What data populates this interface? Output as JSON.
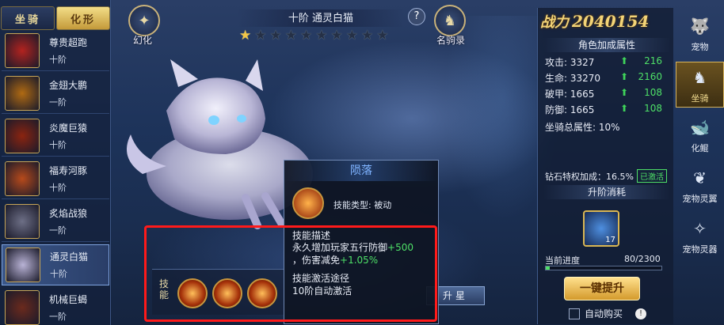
{
  "left_tabs": {
    "mount": "坐骑",
    "transform": "化形"
  },
  "mount_list": [
    {
      "name": "尊贵超跑",
      "tier": "十阶",
      "badge": "",
      "color": "#b3231f"
    },
    {
      "name": "金翅大鹏",
      "tier": "一阶",
      "badge": "",
      "color": "#b06a12"
    },
    {
      "name": "炎魔巨猿",
      "tier": "十阶",
      "badge": "",
      "color": "#8b2410"
    },
    {
      "name": "福寿河豚",
      "tier": "十阶",
      "badge": "",
      "color": "#b74a1b"
    },
    {
      "name": "炙焰战狼",
      "tier": "一阶",
      "badge": "",
      "color": "#6d6f86"
    },
    {
      "name": "通灵白猫",
      "tier": "十阶",
      "badge": "",
      "color": "#b9b3d6"
    },
    {
      "name": "机械巨蝎",
      "tier": "一阶",
      "badge": "",
      "color": "#6b2a1d"
    }
  ],
  "top": {
    "transform_label": "幻化",
    "collection_label": "名驹录",
    "title": "十阶 通灵白猫",
    "help": "?"
  },
  "stars": {
    "lit": 1,
    "total": 10
  },
  "power": {
    "label": "战力",
    "value": "2040154"
  },
  "attributes": {
    "section_title": "角色加成属性",
    "rows": [
      {
        "label": "攻击: 3327",
        "inc": "216"
      },
      {
        "label": "生命: 33270",
        "inc": "2160"
      },
      {
        "label": "破甲: 1665",
        "inc": "108"
      },
      {
        "label": "防御: 1665",
        "inc": "108"
      }
    ],
    "total": "坐骑总属性: 10%"
  },
  "diamond": {
    "text": "钻石特权加成：16.5%",
    "status": "已激活"
  },
  "upgrade": {
    "section_title": "升阶消耗",
    "item_count": "17",
    "progress_label": "当前进度",
    "progress_text": "80/2300",
    "progress_fraction": 0.035,
    "button": "一键提升",
    "auto_buy": "自动购买",
    "info": "!"
  },
  "nav": [
    {
      "label": "宠物",
      "icon": "pet-icon"
    },
    {
      "label": "坐骑",
      "icon": "mount-icon"
    },
    {
      "label": "化鲲",
      "icon": "kun-icon"
    },
    {
      "label": "宠物灵翼",
      "icon": "wing-icon"
    },
    {
      "label": "宠物灵器",
      "icon": "artifact-icon"
    }
  ],
  "skill_tooltip": {
    "title": "陨落",
    "type": "技能类型:  被动",
    "desc_heading": "技能描述",
    "desc_line1_a": "永久增加玩家五行防御",
    "desc_line1_b": "+500",
    "desc_line2_a": "，伤害减免",
    "desc_line2_b": "+1.05%",
    "activate_heading": "技能激活途径",
    "activate_text": "10阶自动激活"
  },
  "skill_bar": {
    "label": "技能",
    "star_button": "升星"
  },
  "colors": {
    "highlight_frame": "#ff1a1a",
    "increase_green": "#4ee067",
    "gold": "#f3d477"
  }
}
